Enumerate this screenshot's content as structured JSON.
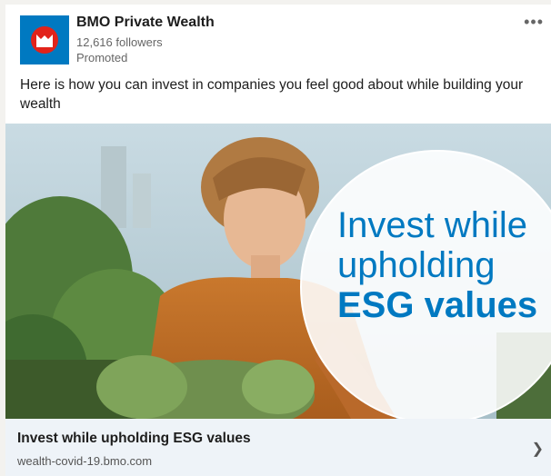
{
  "post": {
    "company": "BMO Private Wealth",
    "followers": "12,616 followers",
    "promoted": "Promoted",
    "text": "Here is how you can invest in companies you feel good about while building your wealth",
    "more_icon": "more-horizontal-icon"
  },
  "ad_image": {
    "line1": "Invest while",
    "line2": "upholding",
    "line3": "ESG values"
  },
  "link": {
    "title": "Invest while upholding ESG values",
    "url": "wealth-covid-19.bmo.com",
    "chevron_icon": "chevron-right-icon"
  },
  "colors": {
    "brand_blue": "#0079c1",
    "brand_red": "#e2231a",
    "footer_bg": "#eef3f8"
  }
}
